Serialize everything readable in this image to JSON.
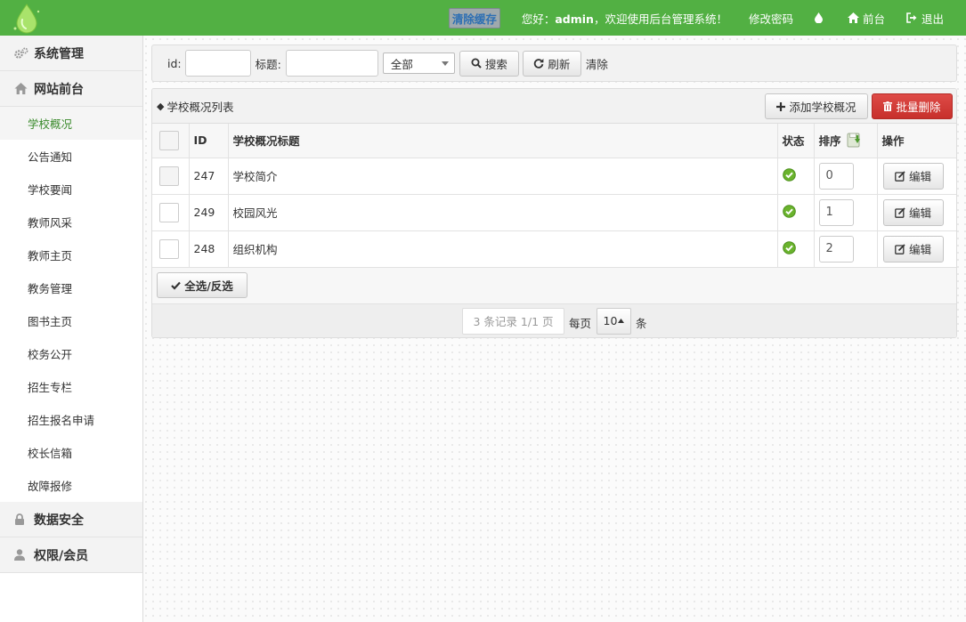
{
  "topbar": {
    "clear_cache": "清除缓存",
    "greeting_prefix": "您好：",
    "username": "admin",
    "greeting_suffix": "，欢迎使用后台管理系统！",
    "change_password": "修改密码",
    "frontend": "前台",
    "logout": "退出",
    "accent_color": "#52b043"
  },
  "sidebar": {
    "groups": [
      {
        "label": "系统管理",
        "icon": "gears-icon"
      },
      {
        "label": "网站前台",
        "icon": "home-icon"
      },
      {
        "label": "数据安全",
        "icon": "lock-icon"
      },
      {
        "label": "权限/会员",
        "icon": "user-icon"
      }
    ],
    "items": [
      "学校概况",
      "公告通知",
      "学校要闻",
      "教师风采",
      "教师主页",
      "教务管理",
      "图书主页",
      "校务公开",
      "招生专栏",
      "招生报名申请",
      "校长信箱",
      "故障报修"
    ],
    "active_item": "学校概况"
  },
  "search": {
    "id_label": "id:",
    "title_label": "标题:",
    "id_value": "",
    "title_value": "",
    "status_selected": "全部",
    "search_button": "搜索",
    "refresh_button": "刷新",
    "clear_link": "清除"
  },
  "list": {
    "title": "学校概况列表",
    "add_button": "添加学校概况",
    "batch_delete_button": "批量删除",
    "columns": {
      "id": "ID",
      "title": "学校概况标题",
      "status": "状态",
      "sort": "排序",
      "action": "操作"
    },
    "rows": [
      {
        "id": "247",
        "title": "学校简介",
        "status": "enabled",
        "sort": "0",
        "action": "编辑"
      },
      {
        "id": "249",
        "title": "校园风光",
        "status": "enabled",
        "sort": "1",
        "action": "编辑"
      },
      {
        "id": "248",
        "title": "组织机构",
        "status": "enabled",
        "sort": "2",
        "action": "编辑"
      }
    ],
    "select_all_button": "全选/反选",
    "danger_color": "#d9433e"
  },
  "pager": {
    "info": "3 条记录 1/1 页",
    "per_page_label": "每页",
    "per_page_value": "10",
    "per_page_unit": "条"
  }
}
